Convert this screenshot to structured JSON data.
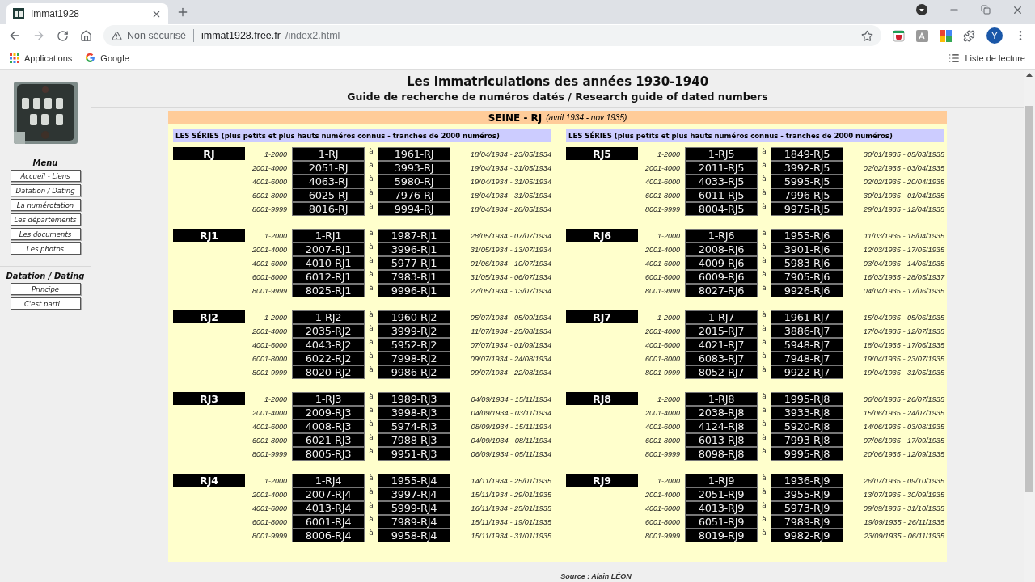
{
  "browser": {
    "tab_title": "Immat1928",
    "forward_disabled": true,
    "security": "Non sécurisé",
    "url_host": "immat1928.free.fr",
    "url_path": "/index2.html",
    "avatar": "Y",
    "bookmarks": [
      {
        "kind": "apps",
        "label": "Applications"
      },
      {
        "kind": "google",
        "label": "Google"
      }
    ],
    "reading_list": "Liste de lecture"
  },
  "sidebar": {
    "menus": [
      {
        "title": "Menu",
        "items": [
          "Accueil - Liens",
          "Datation / Dating",
          "La numérotation",
          "Les départements",
          "Les documents",
          "Les photos"
        ]
      },
      {
        "title": "Datation / Dating",
        "items": [
          "Principe",
          "C'est parti..."
        ]
      }
    ]
  },
  "header": {
    "title": "Les immatriculations des années 1930-1940",
    "subtitle": "Guide de recherche de numéros datés / Research guide of dated numbers"
  },
  "panel": {
    "title": "SEINE - RJ",
    "period": "(avril 1934 - nov 1935)",
    "columns": [
      {
        "heading": "LES SÉRIES (plus petits et plus hauts numéros connus - tranches de 2000 numéros)",
        "series": [
          {
            "name": "RJ",
            "rows": [
              {
                "range": "1-2000",
                "from": "1-RJ",
                "sep": "à",
                "to": "1961-RJ",
                "dates": "18/04/1934 - 23/05/1934"
              },
              {
                "range": "2001-4000",
                "from": "2051-RJ",
                "sep": "à",
                "to": "3993-RJ",
                "dates": "19/04/1934 - 31/05/1934"
              },
              {
                "range": "4001-6000",
                "from": "4063-RJ",
                "sep": "à",
                "to": "5980-RJ",
                "dates": "19/04/1934 - 31/05/1934"
              },
              {
                "range": "6001-8000",
                "from": "6025-RJ",
                "sep": "à",
                "to": "7976-RJ",
                "dates": "18/04/1934 - 31/05/1934"
              },
              {
                "range": "8001-9999",
                "from": "8016-RJ",
                "sep": "à",
                "to": "9994-RJ",
                "dates": "18/04/1934 - 28/05/1934"
              }
            ]
          },
          {
            "name": "RJ1",
            "rows": [
              {
                "range": "1-2000",
                "from": "1-RJ1",
                "sep": "à",
                "to": "1987-RJ1",
                "dates": "28/05/1934 - 07/07/1934"
              },
              {
                "range": "2001-4000",
                "from": "2007-RJ1",
                "sep": "à",
                "to": "3996-RJ1",
                "dates": "31/05/1934 - 13/07/1934"
              },
              {
                "range": "4001-6000",
                "from": "4010-RJ1",
                "sep": "à",
                "to": "5977-RJ1",
                "dates": "01/06/1934 - 10/07/1934"
              },
              {
                "range": "6001-8000",
                "from": "6012-RJ1",
                "sep": "à",
                "to": "7983-RJ1",
                "dates": "31/05/1934 - 06/07/1934"
              },
              {
                "range": "8001-9999",
                "from": "8025-RJ1",
                "sep": "à",
                "to": "9996-RJ1",
                "dates": "27/05/1934 - 13/07/1934"
              }
            ]
          },
          {
            "name": "RJ2",
            "rows": [
              {
                "range": "1-2000",
                "from": "1-RJ2",
                "sep": "à",
                "to": "1960-RJ2",
                "dates": "05/07/1934 - 05/09/1934"
              },
              {
                "range": "2001-4000",
                "from": "2035-RJ2",
                "sep": "à",
                "to": "3999-RJ2",
                "dates": "11/07/1934 - 25/08/1934"
              },
              {
                "range": "4001-6000",
                "from": "4043-RJ2",
                "sep": "à",
                "to": "5952-RJ2",
                "dates": "07/07/1934 - 01/09/1934"
              },
              {
                "range": "6001-8000",
                "from": "6022-RJ2",
                "sep": "à",
                "to": "7998-RJ2",
                "dates": "09/07/1934 - 24/08/1934"
              },
              {
                "range": "8001-9999",
                "from": "8020-RJ2",
                "sep": "à",
                "to": "9986-RJ2",
                "dates": "09/07/1934 - 22/08/1934"
              }
            ]
          },
          {
            "name": "RJ3",
            "rows": [
              {
                "range": "1-2000",
                "from": "1-RJ3",
                "sep": "à",
                "to": "1989-RJ3",
                "dates": "04/09/1934 - 15/11/1934"
              },
              {
                "range": "2001-4000",
                "from": "2009-RJ3",
                "sep": "à",
                "to": "3998-RJ3",
                "dates": "04/09/1934 - 03/11/1934"
              },
              {
                "range": "4001-6000",
                "from": "4008-RJ3",
                "sep": "à",
                "to": "5974-RJ3",
                "dates": "08/09/1934 - 15/11/1934"
              },
              {
                "range": "6001-8000",
                "from": "6021-RJ3",
                "sep": "à",
                "to": "7988-RJ3",
                "dates": "04/09/1934 - 08/11/1934"
              },
              {
                "range": "8001-9999",
                "from": "8005-RJ3",
                "sep": "à",
                "to": "9951-RJ3",
                "dates": "06/09/1934 - 05/11/1934"
              }
            ]
          },
          {
            "name": "RJ4",
            "rows": [
              {
                "range": "1-2000",
                "from": "1-RJ4",
                "sep": "à",
                "to": "1955-RJ4",
                "dates": "14/11/1934 - 25/01/1935"
              },
              {
                "range": "2001-4000",
                "from": "2007-RJ4",
                "sep": "à",
                "to": "3997-RJ4",
                "dates": "15/11/1934 - 29/01/1935"
              },
              {
                "range": "4001-6000",
                "from": "4013-RJ4",
                "sep": "à",
                "to": "5999-RJ4",
                "dates": "16/11/1934 - 25/01/1935"
              },
              {
                "range": "6001-8000",
                "from": "6001-RJ4",
                "sep": "à",
                "to": "7989-RJ4",
                "dates": "15/11/1934 - 19/01/1935"
              },
              {
                "range": "8001-9999",
                "from": "8006-RJ4",
                "sep": "à",
                "to": "9958-RJ4",
                "dates": "15/11/1934 - 31/01/1935"
              }
            ]
          }
        ]
      },
      {
        "heading": "LES SÉRIES (plus petits et plus hauts numéros connus - tranches de 2000 numéros)",
        "series": [
          {
            "name": "RJ5",
            "rows": [
              {
                "range": "1-2000",
                "from": "1-RJ5",
                "sep": "à",
                "to": "1849-RJ5",
                "dates": "30/01/1935 - 05/03/1935"
              },
              {
                "range": "2001-4000",
                "from": "2011-RJ5",
                "sep": "à",
                "to": "3992-RJ5",
                "dates": "02/02/1935 - 03/04/1935"
              },
              {
                "range": "4001-6000",
                "from": "4033-RJ5",
                "sep": "à",
                "to": "5995-RJ5",
                "dates": "02/02/1935 - 20/04/1935"
              },
              {
                "range": "6001-8000",
                "from": "6011-RJ5",
                "sep": "à",
                "to": "7996-RJ5",
                "dates": "30/01/1935 - 01/04/1935"
              },
              {
                "range": "8001-9999",
                "from": "8004-RJ5",
                "sep": "à",
                "to": "9975-RJ5",
                "dates": "29/01/1935 - 12/04/1935"
              }
            ]
          },
          {
            "name": "RJ6",
            "rows": [
              {
                "range": "1-2000",
                "from": "1-RJ6",
                "sep": "à",
                "to": "1955-RJ6",
                "dates": "11/03/1935 - 18/04/1935"
              },
              {
                "range": "2001-4000",
                "from": "2008-RJ6",
                "sep": "à",
                "to": "3901-RJ6",
                "dates": "12/03/1935 - 17/05/1935"
              },
              {
                "range": "4001-6000",
                "from": "4009-RJ6",
                "sep": "à",
                "to": "5983-RJ6",
                "dates": "03/04/1935 - 14/06/1935"
              },
              {
                "range": "6001-8000",
                "from": "6009-RJ6",
                "sep": "à",
                "to": "7905-RJ6",
                "dates": "16/03/1935 - 28/05/1937"
              },
              {
                "range": "8001-9999",
                "from": "8027-RJ6",
                "sep": "à",
                "to": "9926-RJ6",
                "dates": "04/04/1935 - 17/06/1935"
              }
            ]
          },
          {
            "name": "RJ7",
            "rows": [
              {
                "range": "1-2000",
                "from": "1-RJ7",
                "sep": "à",
                "to": "1961-RJ7",
                "dates": "15/04/1935 - 05/06/1935"
              },
              {
                "range": "2001-4000",
                "from": "2015-RJ7",
                "sep": "à",
                "to": "3886-RJ7",
                "dates": "17/04/1935 - 12/07/1935"
              },
              {
                "range": "4001-6000",
                "from": "4021-RJ7",
                "sep": "à",
                "to": "5948-RJ7",
                "dates": "18/04/1935 - 17/06/1935"
              },
              {
                "range": "6001-8000",
                "from": "6083-RJ7",
                "sep": "à",
                "to": "7948-RJ7",
                "dates": "19/04/1935 - 23/07/1935"
              },
              {
                "range": "8001-9999",
                "from": "8052-RJ7",
                "sep": "à",
                "to": "9922-RJ7",
                "dates": "19/04/1935 - 31/05/1935"
              }
            ]
          },
          {
            "name": "RJ8",
            "rows": [
              {
                "range": "1-2000",
                "from": "1-RJ8",
                "sep": "à",
                "to": "1995-RJ8",
                "dates": "06/06/1935 - 26/07/1935"
              },
              {
                "range": "2001-4000",
                "from": "2038-RJ8",
                "sep": "à",
                "to": "3933-RJ8",
                "dates": "15/06/1935 - 24/07/1935"
              },
              {
                "range": "4001-6000",
                "from": "4124-RJ8",
                "sep": "à",
                "to": "5920-RJ8",
                "dates": "14/06/1935 - 03/08/1935"
              },
              {
                "range": "6001-8000",
                "from": "6013-RJ8",
                "sep": "à",
                "to": "7993-RJ8",
                "dates": "07/06/1935 - 17/09/1935"
              },
              {
                "range": "8001-9999",
                "from": "8098-RJ8",
                "sep": "à",
                "to": "9995-RJ8",
                "dates": "20/06/1935 - 12/09/1935"
              }
            ]
          },
          {
            "name": "RJ9",
            "rows": [
              {
                "range": "1-2000",
                "from": "1-RJ9",
                "sep": "à",
                "to": "1936-RJ9",
                "dates": "26/07/1935 - 09/10/1935"
              },
              {
                "range": "2001-4000",
                "from": "2051-RJ9",
                "sep": "à",
                "to": "3955-RJ9",
                "dates": "13/07/1935 - 30/09/1935"
              },
              {
                "range": "4001-6000",
                "from": "4013-RJ9",
                "sep": "à",
                "to": "5973-RJ9",
                "dates": "09/09/1935 - 31/10/1935"
              },
              {
                "range": "6001-8000",
                "from": "6051-RJ9",
                "sep": "à",
                "to": "7989-RJ9",
                "dates": "19/09/1935 - 26/11/1935"
              },
              {
                "range": "8001-9999",
                "from": "8019-RJ9",
                "sep": "à",
                "to": "9982-RJ9",
                "dates": "23/09/1935 - 06/11/1935"
              }
            ]
          }
        ]
      }
    ]
  },
  "source": "Source : Alain LÉON"
}
